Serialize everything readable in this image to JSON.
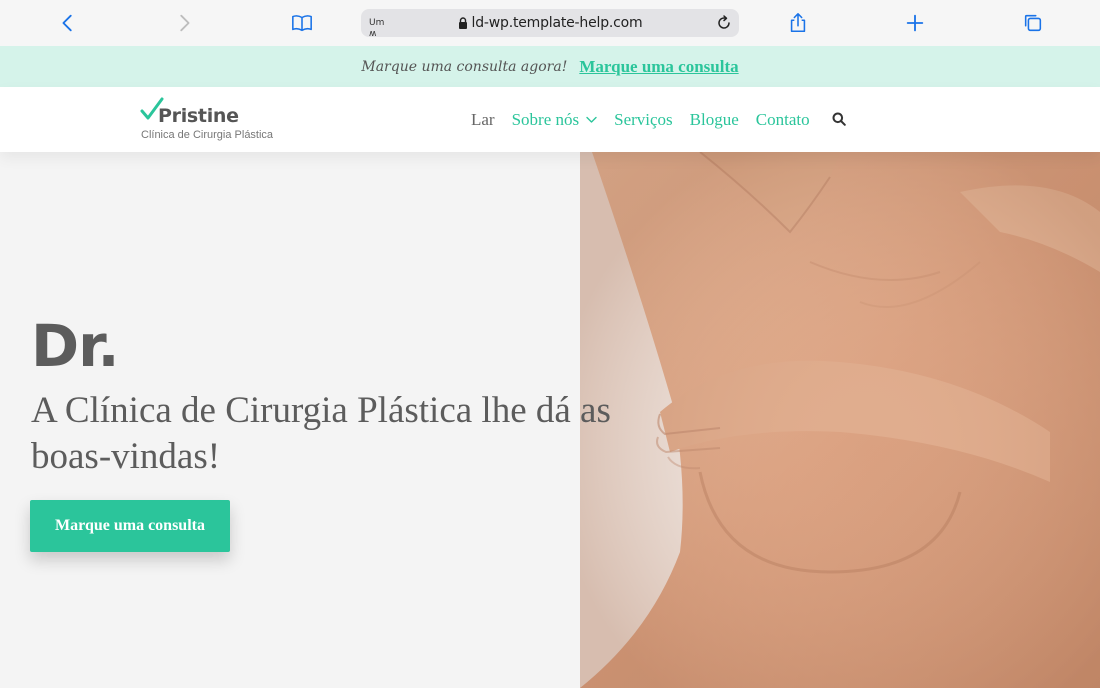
{
  "browser": {
    "reader_label": "Um ʍ",
    "url": "ld-wp.template-help.com",
    "icons": [
      "back-icon",
      "forward-icon",
      "bookmarks-icon",
      "lock-icon",
      "reload-icon",
      "share-icon",
      "new-tab-icon",
      "tabs-icon"
    ],
    "accent_color": "#1a73e8"
  },
  "promo": {
    "text": "Marque uma consulta agora!",
    "link": "Marque uma consulta",
    "background": "#d5f3ea"
  },
  "header": {
    "logo_name": "Pristine",
    "logo_tagline": "Clínica de Cirurgia Plástica",
    "nav": [
      {
        "label": "Lar"
      },
      {
        "label": "Sobre nós"
      },
      {
        "label": "Serviços"
      },
      {
        "label": "Blogue"
      },
      {
        "label": "Contato"
      }
    ],
    "search_icon": "search-icon"
  },
  "hero": {
    "title": "Dr.",
    "subtitle": "A Clínica de Cirurgia Plástica lhe dá as boas-vindas!",
    "cta": "Marque uma consulta"
  },
  "colors": {
    "brand": "#2bc59b",
    "text": "#5c5c5c"
  }
}
